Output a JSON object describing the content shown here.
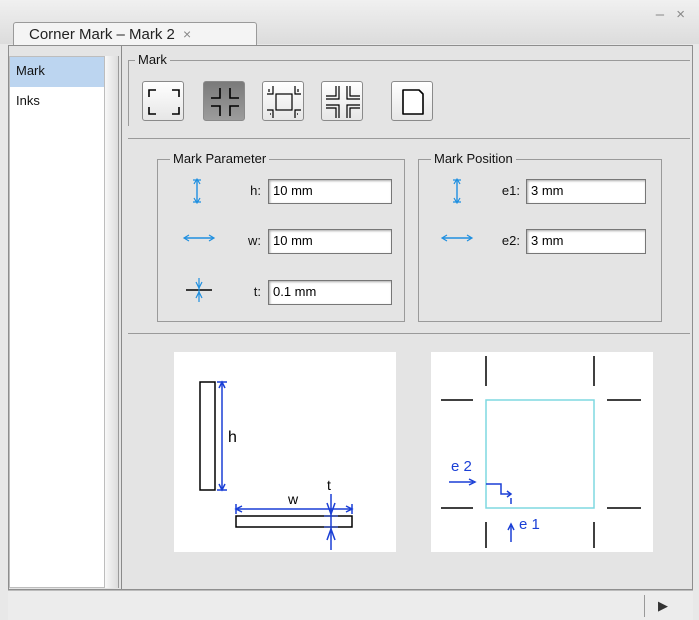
{
  "window": {
    "tab_title": "Corner Mark – Mark 2",
    "tab_close": "×",
    "controls": "– ×"
  },
  "sidebar": {
    "items": [
      {
        "label": "Mark",
        "active": true
      },
      {
        "label": "Inks",
        "active": false
      }
    ]
  },
  "mark_group": {
    "legend": "Mark",
    "buttons": [
      {
        "name": "corner-mark-simple",
        "selected": false
      },
      {
        "name": "corner-mark-cross",
        "selected": true
      },
      {
        "name": "corner-mark-double",
        "selected": false
      },
      {
        "name": "corner-mark-grid",
        "selected": false
      },
      {
        "name": "page-shape",
        "selected": false
      }
    ]
  },
  "mark_parameter": {
    "legend": "Mark Parameter",
    "h_label": "h:",
    "h_value": "10 mm",
    "w_label": "w:",
    "w_value": "10 mm",
    "t_label": "t:",
    "t_value": "0.1 mm"
  },
  "mark_position": {
    "legend": "Mark Position",
    "e1_label": "e1:",
    "e1_value": "3 mm",
    "e2_label": "e2:",
    "e2_value": "3 mm"
  },
  "preview_params": {
    "h": "h",
    "w": "w",
    "t": "t"
  },
  "preview_position": {
    "e1": "e 1",
    "e2": "e 2"
  },
  "status": {
    "arrow": "▶"
  },
  "colors": {
    "accent_blue": "#1a3fd6",
    "icon_blue": "#1e8fe0",
    "preview_square": "#7fd8e0",
    "selected_item": "#bcd5f0"
  }
}
